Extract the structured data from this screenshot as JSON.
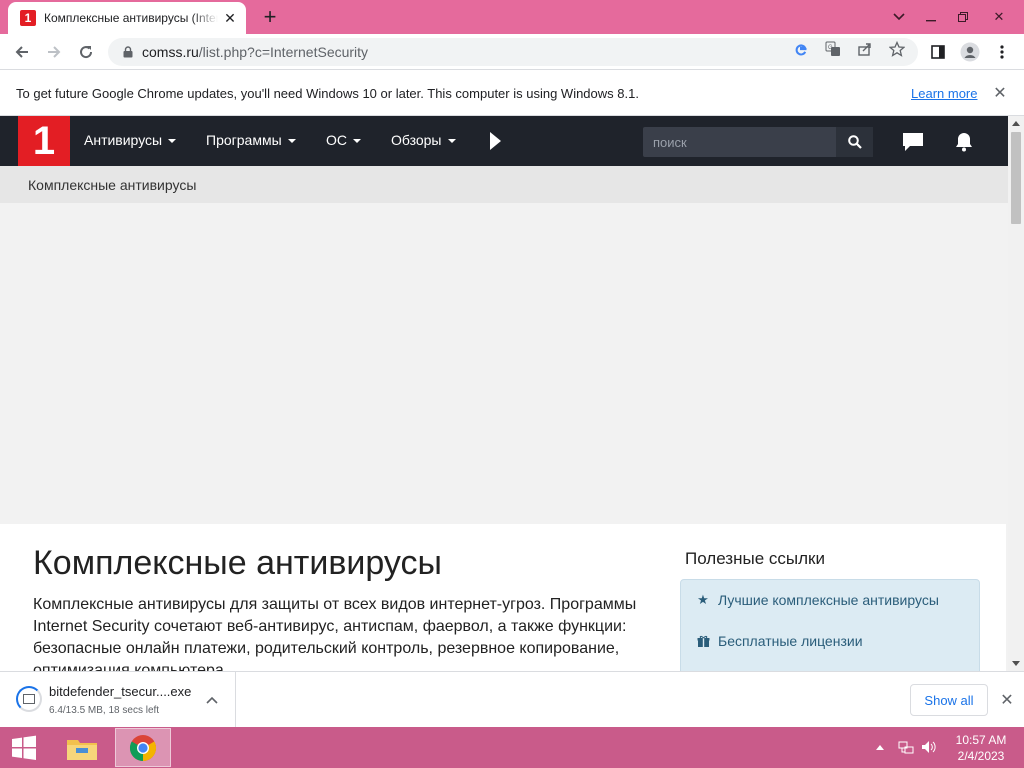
{
  "browser": {
    "tab": {
      "title": "Комплексные антивирусы (Internet Security)",
      "favicon_text": "1",
      "close_glyph": "✕"
    },
    "new_tab_glyph": "+",
    "window_controls": {
      "minimize_glyph": "⌄",
      "restore_glyph": "❐",
      "close_glyph": "✕"
    },
    "address": {
      "host": "comss.ru",
      "path": "/list.php?c=InternetSecurity"
    },
    "infobar": {
      "message": "To get future Google Chrome updates, you'll need Windows 10 or later. This computer is using Windows 8.1.",
      "learn_more": "Learn more",
      "close_glyph": "✕"
    }
  },
  "site": {
    "logo_text": "1",
    "nav": [
      {
        "label": "Антивирусы"
      },
      {
        "label": "Программы"
      },
      {
        "label": "ОС"
      },
      {
        "label": "Обзоры"
      }
    ],
    "search_placeholder": "поиск",
    "breadcrumb": "Комплексные антивирусы",
    "heading": "Комплексные антивирусы",
    "lead": "Комплексные антивирусы для защиты от всех видов интернет-угроз. Программы Internet Security сочетают веб-антивирус, антиспам, фаервол, а также функции: безопасные онлайн платежи, родительский контроль, резервное копирование, оптимизация компьютера.",
    "sidebar": {
      "title": "Полезные ссылки",
      "links": [
        {
          "icon": "star-icon",
          "glyph": "★",
          "label": "Лучшие комплексные антивирусы"
        },
        {
          "icon": "gift-icon",
          "glyph": "🎁",
          "label": "Бесплатные лицензии"
        }
      ]
    }
  },
  "downloads": {
    "file_name": "bitdefender_tsecur....exe",
    "status": "6.4/13.5 MB, 18 secs left",
    "show_all": "Show all",
    "close_glyph": "✕"
  },
  "taskbar": {
    "time": "10:57 AM",
    "date": "2/4/2023"
  },
  "colors": {
    "titlebar": "#e56a9c",
    "taskbar": "#c95b8a",
    "site_nav": "#1f232b",
    "brand_red": "#e31e24",
    "link_blue": "#1a73e8"
  }
}
